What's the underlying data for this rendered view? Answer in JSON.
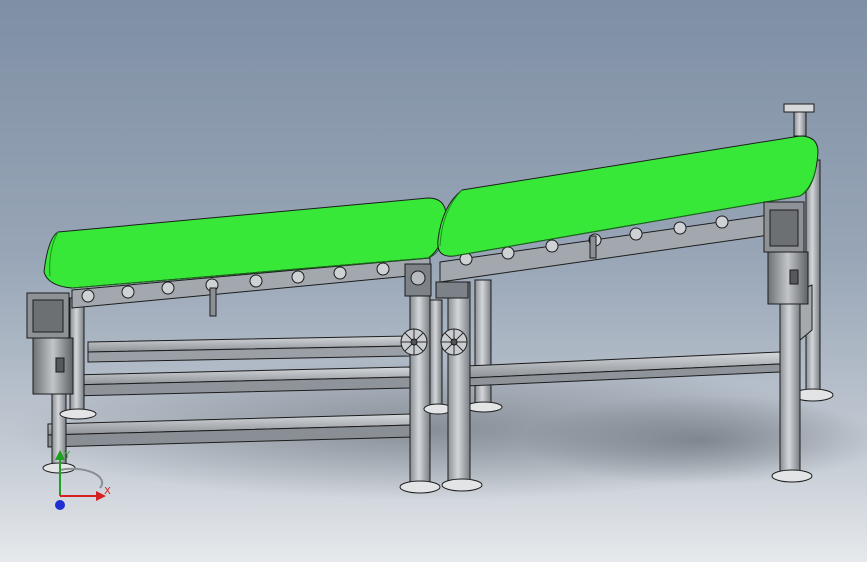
{
  "scene": {
    "subject": "",
    "colors": {
      "background_top": "#7f8fa4",
      "background_bottom": "#e6e9ec",
      "belt": "#38e838",
      "belt_dark": "#22b022",
      "frame": "#a7abb1",
      "frame_dark": "#5f646b",
      "frame_light": "#d8dbde",
      "motor": "#8e9296",
      "outline": "#1c1c1c"
    }
  },
  "triad": {
    "x_label": "X",
    "y_label": "Y",
    "x_color": "#d42020",
    "y_color": "#20a020",
    "z_color": "#2030d0"
  }
}
